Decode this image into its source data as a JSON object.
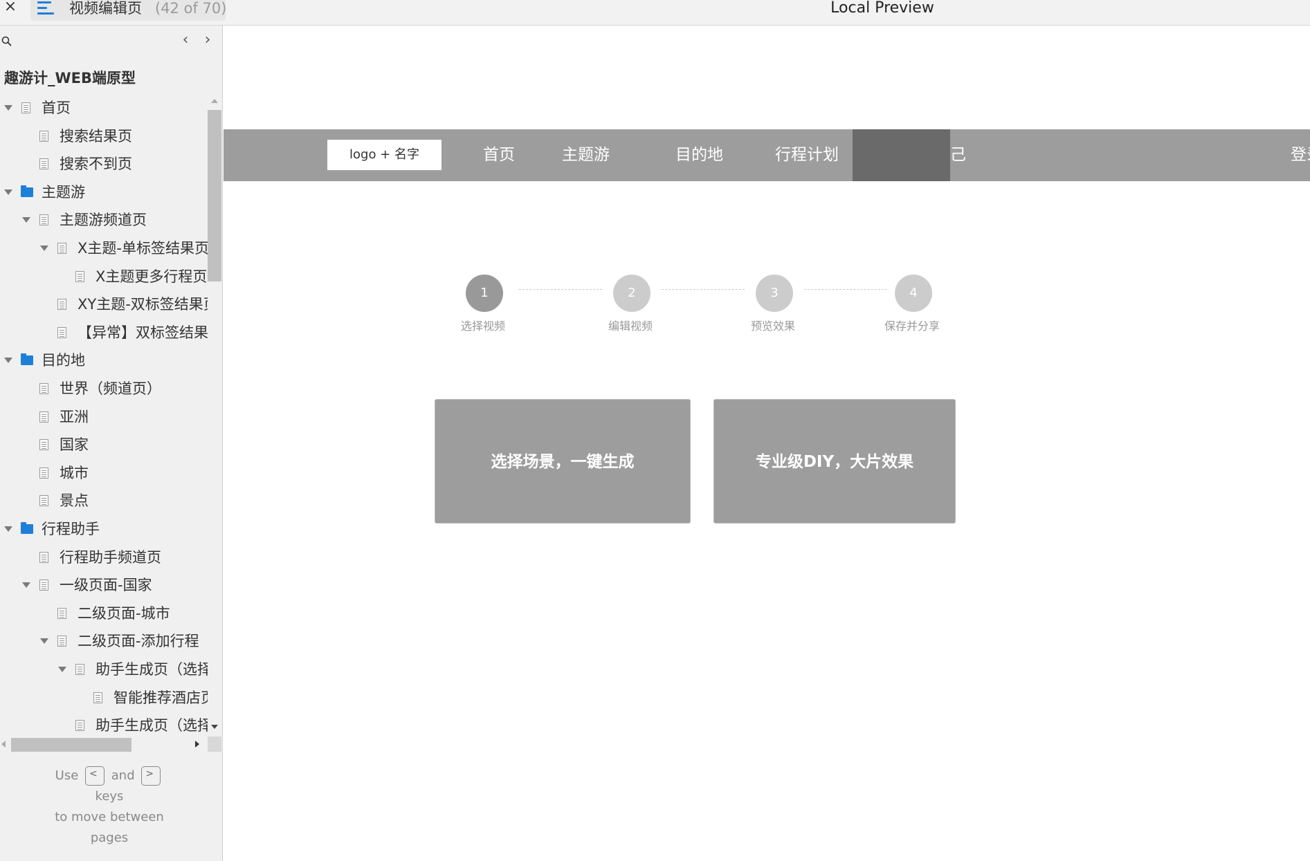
{
  "window": {
    "close_icon": "close-icon",
    "page_title": "视频编辑页",
    "page_count": "(42 of 70)",
    "preview_title": "Local Preview"
  },
  "sidebar": {
    "project_title": "趣游计_WEB端原型",
    "tree": [
      {
        "label": "首页",
        "type": "page",
        "level": 0,
        "expanded": true
      },
      {
        "label": "搜索结果页",
        "type": "page",
        "level": 1
      },
      {
        "label": "搜索不到页",
        "type": "page",
        "level": 1
      },
      {
        "label": "主题游",
        "type": "folder",
        "level": 0,
        "expanded": true
      },
      {
        "label": "主题游频道页",
        "type": "page",
        "level": 1,
        "expanded": true
      },
      {
        "label": "X主题-单标签结果页",
        "type": "page",
        "level": 2,
        "expanded": true
      },
      {
        "label": "X主题更多行程页",
        "type": "page",
        "level": 3
      },
      {
        "label": "XY主题-双标签结果页",
        "type": "page",
        "level": 2
      },
      {
        "label": "【异常】双标签结果",
        "type": "page",
        "level": 2
      },
      {
        "label": "目的地",
        "type": "folder",
        "level": 0,
        "expanded": true
      },
      {
        "label": "世界（频道页）",
        "type": "page",
        "level": 1
      },
      {
        "label": "亚洲",
        "type": "page",
        "level": 1
      },
      {
        "label": "国家",
        "type": "page",
        "level": 1
      },
      {
        "label": "城市",
        "type": "page",
        "level": 1
      },
      {
        "label": "景点",
        "type": "page",
        "level": 1
      },
      {
        "label": "行程助手",
        "type": "folder",
        "level": 0,
        "expanded": true
      },
      {
        "label": "行程助手频道页",
        "type": "page",
        "level": 1
      },
      {
        "label": "一级页面-国家",
        "type": "page",
        "level": 1,
        "expanded": true
      },
      {
        "label": "二级页面-城市",
        "type": "page",
        "level": 2
      },
      {
        "label": "二级页面-添加行程",
        "type": "page",
        "level": 2,
        "expanded": true
      },
      {
        "label": "助手生成页（选择",
        "type": "page",
        "level": 3,
        "expanded": true
      },
      {
        "label": "智能推荐酒店页",
        "type": "page",
        "level": 4
      },
      {
        "label": "助手生成页（选择",
        "type": "page",
        "level": 3
      }
    ],
    "hint": {
      "use": "Use",
      "and": "and",
      "keys": "keys",
      "to_move": "to move between",
      "pages": "pages",
      "prev_key": "<",
      "next_key": ">"
    }
  },
  "prototype": {
    "logo": "logo + 名字",
    "nav": [
      "首页",
      "主题游",
      "目的地",
      "行程计划"
    ],
    "nav_partial": "己",
    "login": "登录",
    "steps": [
      {
        "number": "1",
        "label": "选择视频",
        "active": true
      },
      {
        "number": "2",
        "label": "编辑视频",
        "active": false
      },
      {
        "number": "3",
        "label": "预览效果",
        "active": false
      },
      {
        "number": "4",
        "label": "保存并分享",
        "active": false
      }
    ],
    "cards": [
      {
        "label": "选择场景，一键生成"
      },
      {
        "label": "专业级DIY，大片效果"
      }
    ]
  },
  "colors": {
    "accent": "#1e7fd8",
    "nav_bg": "#9d9d9d",
    "nav_active": "#6a6a6a",
    "step_active": "#999999",
    "step_inactive": "#cccccc"
  }
}
